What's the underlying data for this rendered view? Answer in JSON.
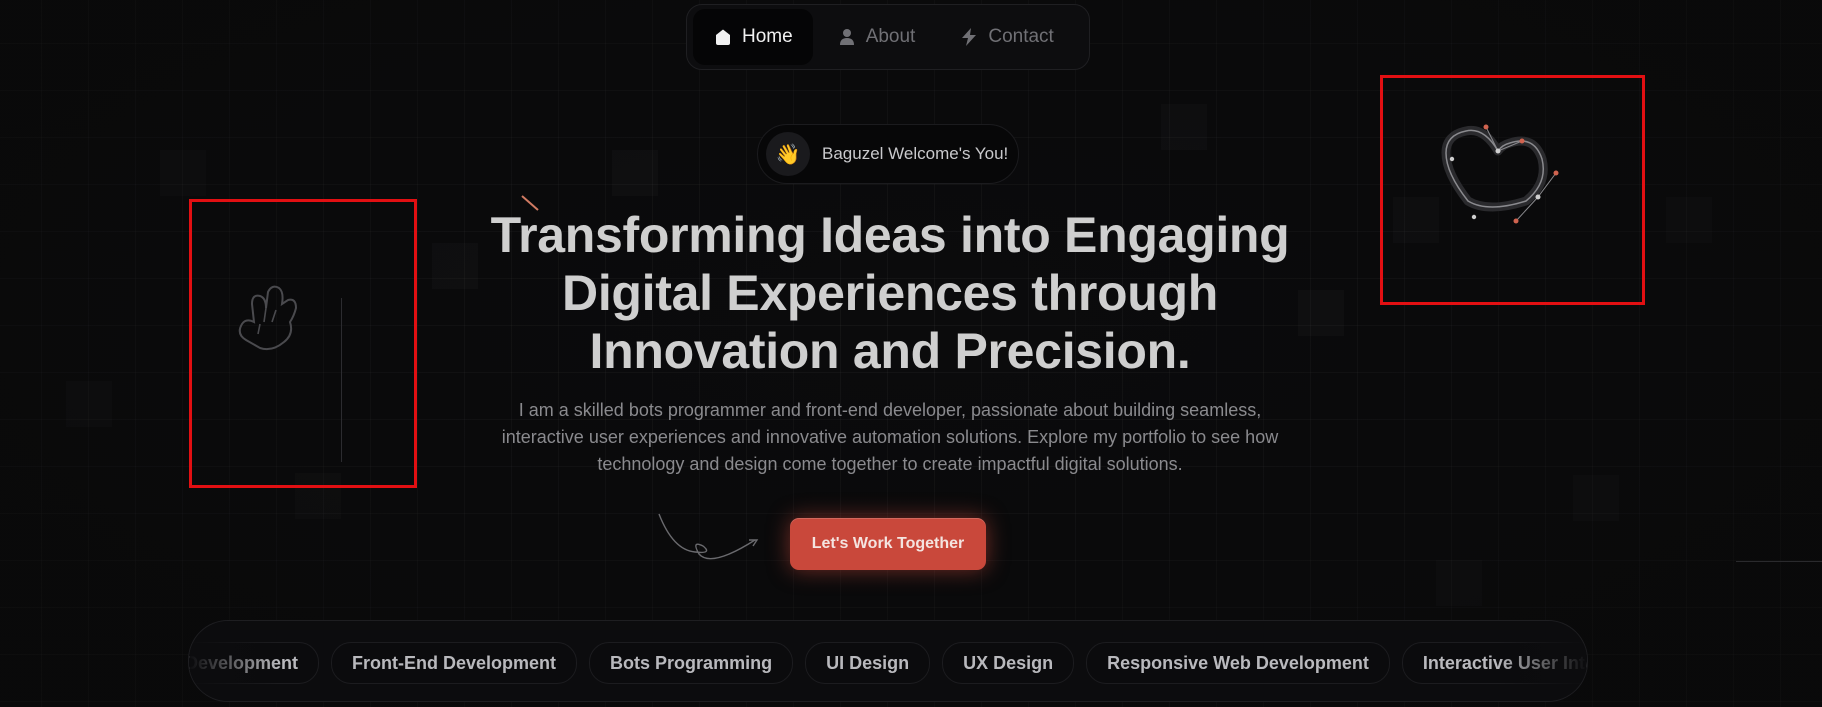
{
  "nav": {
    "items": [
      {
        "label": "Home",
        "icon": "home-icon",
        "active": true
      },
      {
        "label": "About",
        "icon": "user-icon",
        "active": false
      },
      {
        "label": "Contact",
        "icon": "lightning-icon",
        "active": false
      }
    ]
  },
  "welcome": {
    "emoji": "👋",
    "text": "Baguzel Welcome's You!"
  },
  "hero": {
    "title_line1": "Transforming Ideas into Engaging",
    "title_line2": "Digital Experiences through",
    "title_line3": "Innovation and Precision.",
    "description": "I am a skilled bots programmer and front-end developer, passionate about building seamless, interactive user experiences and innovative automation solutions. Explore my portfolio to see how technology and design come together to create impactful digital solutions."
  },
  "cta": {
    "label": "Let's Work Together"
  },
  "skills": [
    "Development",
    "Front-End Development",
    "Bots Programming",
    "UI Design",
    "UX Design",
    "Responsive Web Development",
    "Interactive User Interfaces"
  ],
  "colors": {
    "accent": "#c9483b",
    "highlight_box": "#e20f12",
    "background": "#0b0b0c"
  },
  "decorations": {
    "left_icon": "peace-hand-icon",
    "right_icon": "heart-vector-icon"
  }
}
